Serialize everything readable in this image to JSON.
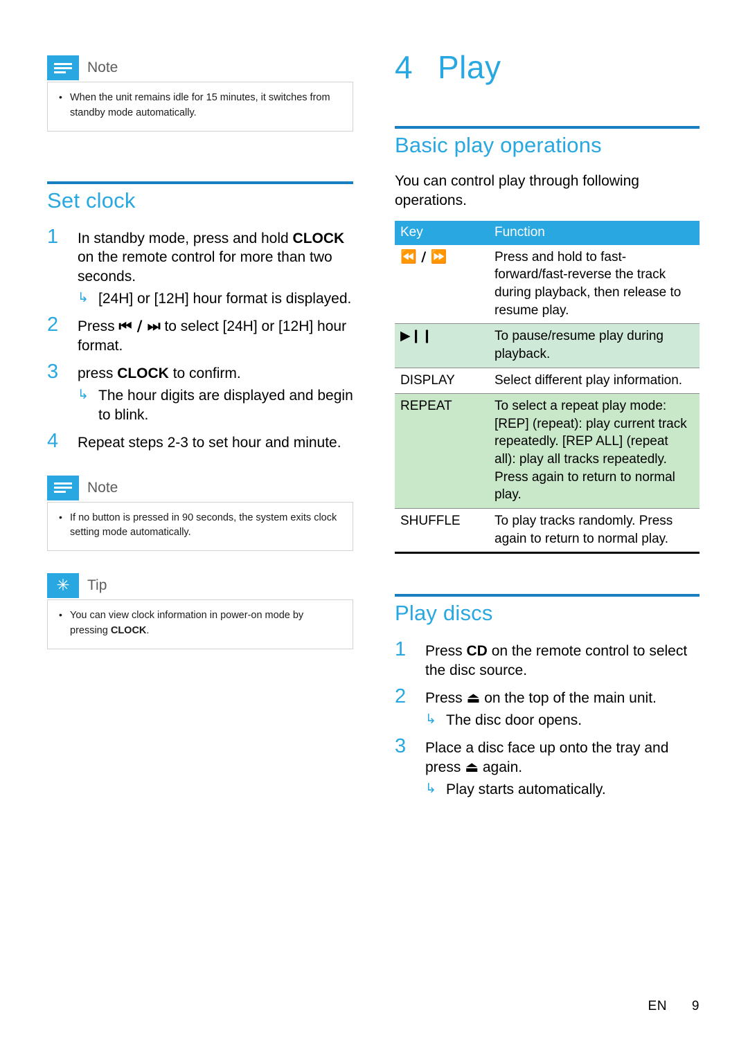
{
  "left_column": {
    "note_top": {
      "title": "Note",
      "icon": "note-icon",
      "items": [
        "When the unit remains idle for 15 minutes, it switches from standby mode automatically."
      ]
    },
    "set_clock": {
      "heading": "Set clock",
      "steps": [
        {
          "num": "1",
          "text_parts": [
            "In standby mode, press and hold ",
            "CLOCK",
            " on the remote control for more than two seconds."
          ],
          "sub": "[24H] or [12H] hour format is displayed."
        },
        {
          "num": "2",
          "text_parts": [
            "Press ",
            "⏮ / ⏭",
            " to select [24H] or [12H] hour format."
          ],
          "sub": ""
        },
        {
          "num": "3",
          "text_parts": [
            "press ",
            "CLOCK",
            " to confirm."
          ],
          "sub": "The hour digits are displayed and begin to blink."
        },
        {
          "num": "4",
          "text_parts": [
            "Repeat steps 2-3 to set hour and minute."
          ],
          "sub": ""
        }
      ]
    },
    "note_bottom": {
      "title": "Note",
      "icon": "note-icon",
      "items": [
        "If no button is pressed in 90 seconds, the system exits clock setting mode automatically."
      ]
    },
    "tip": {
      "title": "Tip",
      "icon": "tip-star-icon",
      "text_before": "You can view clock information in power-on mode by pressing ",
      "text_bold": "CLOCK",
      "text_after": "."
    }
  },
  "right_column": {
    "chapter_number": "4",
    "chapter_title": "Play",
    "basic_play": {
      "heading": "Basic play operations",
      "intro": "You can control play through following operations.",
      "table": {
        "headers": [
          "Key",
          "Function"
        ],
        "rows": [
          {
            "key": "⏪ / ⏩",
            "function": "Press and hold to fast-forward/fast-reverse the track during playback, then release to resume play.",
            "shaded": false
          },
          {
            "key": "▶❙❙",
            "function": "To pause/resume play during playback.",
            "shaded": true
          },
          {
            "key": "DISPLAY",
            "function": "Select different play information.",
            "shaded": false
          },
          {
            "key": "REPEAT",
            "function": "To select a repeat play mode: [REP] (repeat): play current track repeatedly. [REP ALL] (repeat all): play all tracks repeatedly. Press again to return to normal play.",
            "shaded": true
          },
          {
            "key": "SHUFFLE",
            "function": "To play tracks randomly. Press again to return to normal play.",
            "shaded": false
          }
        ]
      }
    },
    "play_discs": {
      "heading": "Play discs",
      "steps": [
        {
          "num": "1",
          "text_parts": [
            "Press ",
            "CD",
            " on the remote control to select the disc source."
          ],
          "sub": ""
        },
        {
          "num": "2",
          "text_parts": [
            "Press ",
            "⏏",
            " on the top of the main unit."
          ],
          "sub": "The disc door opens."
        },
        {
          "num": "3",
          "text_parts": [
            "Place a disc face up onto the tray and press ",
            "⏏",
            " again."
          ],
          "sub": "Play starts automatically."
        }
      ]
    }
  },
  "footer": {
    "language": "EN",
    "page_number": "9"
  }
}
